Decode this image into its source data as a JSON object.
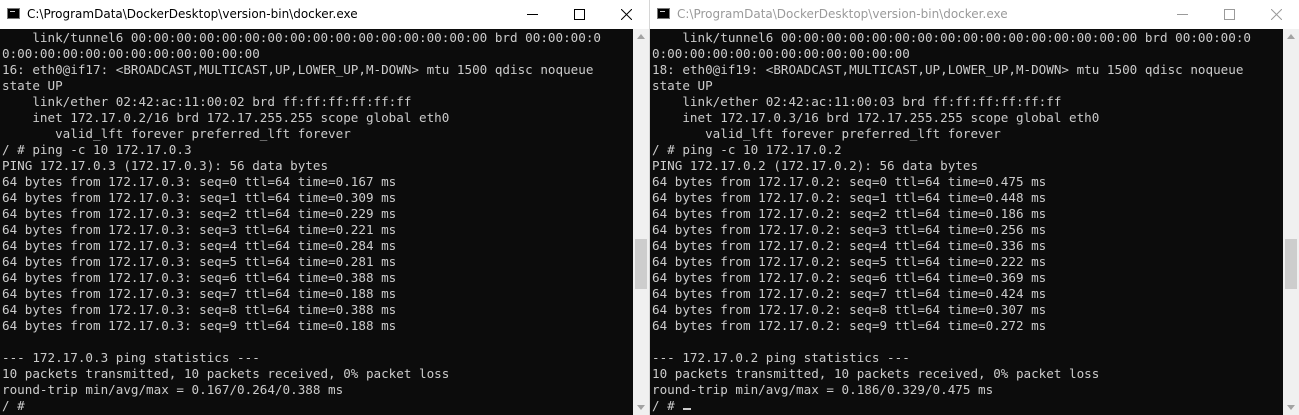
{
  "left": {
    "title": "C:\\ProgramData\\DockerDesktop\\version-bin\\docker.exe",
    "lines": [
      "    link/tunnel6 00:00:00:00:00:00:00:00:00:00:00:00:00:00:00:00 brd 00:00:00:0",
      "0:00:00:00:00:00:00:00:00:00:00:00",
      "16: eth0@if17: <BROADCAST,MULTICAST,UP,LOWER_UP,M-DOWN> mtu 1500 qdisc noqueue",
      "state UP",
      "    link/ether 02:42:ac:11:00:02 brd ff:ff:ff:ff:ff:ff",
      "    inet 172.17.0.2/16 brd 172.17.255.255 scope global eth0",
      "       valid_lft forever preferred_lft forever",
      "/ # ping -c 10 172.17.0.3",
      "PING 172.17.0.3 (172.17.0.3): 56 data bytes",
      "64 bytes from 172.17.0.3: seq=0 ttl=64 time=0.167 ms",
      "64 bytes from 172.17.0.3: seq=1 ttl=64 time=0.309 ms",
      "64 bytes from 172.17.0.3: seq=2 ttl=64 time=0.229 ms",
      "64 bytes from 172.17.0.3: seq=3 ttl=64 time=0.221 ms",
      "64 bytes from 172.17.0.3: seq=4 ttl=64 time=0.284 ms",
      "64 bytes from 172.17.0.3: seq=5 ttl=64 time=0.281 ms",
      "64 bytes from 172.17.0.3: seq=6 ttl=64 time=0.388 ms",
      "64 bytes from 172.17.0.3: seq=7 ttl=64 time=0.188 ms",
      "64 bytes from 172.17.0.3: seq=8 ttl=64 time=0.388 ms",
      "64 bytes from 172.17.0.3: seq=9 ttl=64 time=0.188 ms",
      "",
      "--- 172.17.0.3 ping statistics ---",
      "10 packets transmitted, 10 packets received, 0% packet loss",
      "round-trip min/avg/max = 0.167/0.264/0.388 ms",
      "/ #"
    ]
  },
  "right": {
    "title": "C:\\ProgramData\\DockerDesktop\\version-bin\\docker.exe",
    "lines": [
      "    link/tunnel6 00:00:00:00:00:00:00:00:00:00:00:00:00:00:00:00 brd 00:00:00:0",
      "0:00:00:00:00:00:00:00:00:00:00:00",
      "18: eth0@if19: <BROADCAST,MULTICAST,UP,LOWER_UP,M-DOWN> mtu 1500 qdisc noqueue",
      "state UP",
      "    link/ether 02:42:ac:11:00:03 brd ff:ff:ff:ff:ff:ff",
      "    inet 172.17.0.3/16 brd 172.17.255.255 scope global eth0",
      "       valid_lft forever preferred_lft forever",
      "/ # ping -c 10 172.17.0.2",
      "PING 172.17.0.2 (172.17.0.2): 56 data bytes",
      "64 bytes from 172.17.0.2: seq=0 ttl=64 time=0.475 ms",
      "64 bytes from 172.17.0.2: seq=1 ttl=64 time=0.448 ms",
      "64 bytes from 172.17.0.2: seq=2 ttl=64 time=0.186 ms",
      "64 bytes from 172.17.0.2: seq=3 ttl=64 time=0.256 ms",
      "64 bytes from 172.17.0.2: seq=4 ttl=64 time=0.336 ms",
      "64 bytes from 172.17.0.2: seq=5 ttl=64 time=0.222 ms",
      "64 bytes from 172.17.0.2: seq=6 ttl=64 time=0.369 ms",
      "64 bytes from 172.17.0.2: seq=7 ttl=64 time=0.424 ms",
      "64 bytes from 172.17.0.2: seq=8 ttl=64 time=0.307 ms",
      "64 bytes from 172.17.0.2: seq=9 ttl=64 time=0.272 ms",
      "",
      "--- 172.17.0.2 ping statistics ---",
      "10 packets transmitted, 10 packets received, 0% packet loss",
      "round-trip min/avg/max = 0.186/0.329/0.475 ms",
      "/ #"
    ]
  },
  "icons": {
    "app": "console-icon",
    "minimize": "minimize-icon",
    "maximize": "maximize-icon",
    "close": "close-icon",
    "scroll_up": "scroll-up-arrow-icon",
    "scroll_down": "scroll-down-arrow-icon"
  },
  "colors": {
    "terminal_bg": "#0c0c0c",
    "terminal_fg": "#cccccc",
    "titlebar_bg": "#ffffff",
    "title_active": "#000000",
    "title_inactive": "#9a9a9a"
  }
}
